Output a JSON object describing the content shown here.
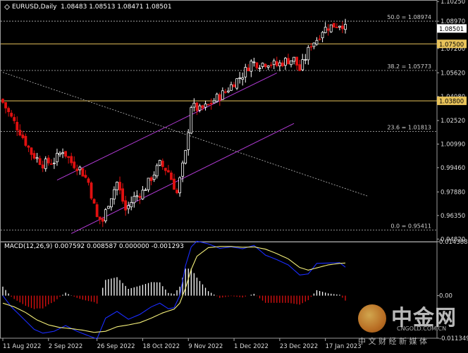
{
  "header": {
    "symbol": "EURUSD,Daily",
    "ohlc": "1.08483 1.08513 1.08471 1.08501"
  },
  "macd_header": {
    "label": "MACD(12,26,9) 0.007592 0.008587 0.000000 -0.001293"
  },
  "watermark": {
    "brand": "中金网",
    "url": "CNGOLD.COM.CN",
    "slogan": "中 文 财 经 新 媒 体"
  },
  "colors": {
    "background": "#000000",
    "bull_candle": "#ffffff",
    "bear_candle": "#e01010",
    "fib_line": "#bdbdbd",
    "horizontal_level": "#e8c35a",
    "channel": "#b23bd6",
    "macd_line": "#1a2cff",
    "signal_line": "#f5f07a",
    "hist_up": "#ffffff",
    "hist_down": "#e01010",
    "current_price_bg": "#ffffff",
    "level_label_bg": "#e8c35a"
  },
  "chart_data": [
    {
      "type": "candlestick",
      "title": "EURUSD,Daily",
      "ylim": [
        0.9465,
        1.1035
      ],
      "y_ticks": [
        "1.10250",
        "1.08970",
        "1.07200",
        "1.05620",
        "1.04080",
        "1.02520",
        "1.00990",
        "0.99460",
        "0.97880",
        "0.96350",
        "0.94820"
      ],
      "x_labels": [
        "11 Aug 2022",
        "2 Sep 2022",
        "26 Sep 2022",
        "18 Oct 2022",
        "9 Nov 2022",
        "1 Dec 2022",
        "23 Dec 2022",
        "17 Jan 2023"
      ],
      "x_label_index": [
        0,
        16,
        33,
        49,
        65,
        81,
        97,
        113
      ],
      "close_path": [
        [
          0,
          1.037
        ],
        [
          3,
          1.027
        ],
        [
          6,
          1.018
        ],
        [
          10,
          1.004
        ],
        [
          14,
          0.997
        ],
        [
          18,
          0.999
        ],
        [
          21,
          1.006
        ],
        [
          24,
          0.998
        ],
        [
          27,
          0.994
        ],
        [
          30,
          0.985
        ],
        [
          33,
          0.962
        ],
        [
          35,
          0.96
        ],
        [
          37,
          0.972
        ],
        [
          40,
          0.985
        ],
        [
          43,
          0.967
        ],
        [
          46,
          0.975
        ],
        [
          49,
          0.979
        ],
        [
          52,
          0.988
        ],
        [
          55,
          0.997
        ],
        [
          58,
          0.992
        ],
        [
          61,
          0.978
        ],
        [
          64,
          1.004
        ],
        [
          66,
          1.035
        ],
        [
          69,
          1.032
        ],
        [
          72,
          1.035
        ],
        [
          75,
          1.04
        ],
        [
          78,
          1.044
        ],
        [
          81,
          1.05
        ],
        [
          84,
          1.055
        ],
        [
          87,
          1.063
        ],
        [
          90,
          1.062
        ],
        [
          93,
          1.063
        ],
        [
          96,
          1.061
        ],
        [
          99,
          1.064
        ],
        [
          102,
          1.065
        ],
        [
          104,
          1.058
        ],
        [
          106,
          1.066
        ],
        [
          108,
          1.075
        ],
        [
          110,
          1.078
        ],
        [
          112,
          1.084
        ],
        [
          114,
          1.086
        ],
        [
          116,
          1.087
        ],
        [
          118,
          1.088
        ],
        [
          119,
          1.0876
        ],
        [
          120,
          1.085
        ]
      ],
      "fibonacci": [
        {
          "label": "50.0 = 1.08974",
          "value": 1.08974
        },
        {
          "label": "38.2 = 1.05773",
          "value": 1.05773
        },
        {
          "label": "23.6 = 1.01813",
          "value": 1.01813
        },
        {
          "label": "0.0 = 0.95411",
          "value": 0.95411
        }
      ],
      "horizontal_levels": [
        {
          "label": "1.07500",
          "value": 1.075
        },
        {
          "label": "1.03800",
          "value": 1.038
        }
      ],
      "current_price": {
        "label": "1.08501",
        "value": 1.08501
      },
      "channel_lines": [
        [
          [
            19,
            0.9865
          ],
          [
            96,
            1.0561
          ]
        ],
        [
          [
            24,
            0.9518
          ],
          [
            102,
            1.0233
          ]
        ]
      ],
      "descending_line": [
        [
          0,
          1.0565
        ],
        [
          128,
          0.976
        ]
      ]
    },
    {
      "type": "macd",
      "title": "MACD(12,26,9) 0.007592 0.008587 0.000000 -0.001293",
      "params": [
        12,
        26,
        9
      ],
      "values": [
        0.007592,
        0.008587,
        0.0,
        -0.001293
      ],
      "ylim": [
        -0.011349,
        0.014388
      ],
      "y_ticks": [
        "0.014388",
        "0.00",
        "-0.011349"
      ],
      "macd_path": [
        [
          0,
          0.0
        ],
        [
          3,
          -0.003
        ],
        [
          7,
          -0.006
        ],
        [
          11,
          -0.009
        ],
        [
          14,
          -0.01
        ],
        [
          18,
          -0.0095
        ],
        [
          22,
          -0.008
        ],
        [
          26,
          -0.0095
        ],
        [
          30,
          -0.0107
        ],
        [
          33,
          -0.0115
        ],
        [
          36,
          -0.006
        ],
        [
          40,
          -0.0042
        ],
        [
          44,
          -0.0063
        ],
        [
          48,
          -0.005
        ],
        [
          52,
          -0.003
        ],
        [
          55,
          -0.002
        ],
        [
          58,
          -0.0035
        ],
        [
          60,
          -0.0032
        ],
        [
          62,
          0.0
        ],
        [
          64,
          0.008
        ],
        [
          66,
          0.013
        ],
        [
          68,
          0.0145
        ],
        [
          72,
          0.0138
        ],
        [
          76,
          0.0126
        ],
        [
          80,
          0.013
        ],
        [
          84,
          0.0125
        ],
        [
          88,
          0.0134
        ],
        [
          92,
          0.0108
        ],
        [
          96,
          0.0096
        ],
        [
          100,
          0.0082
        ],
        [
          104,
          0.0055
        ],
        [
          107,
          0.0058
        ],
        [
          110,
          0.0086
        ],
        [
          114,
          0.0087
        ],
        [
          118,
          0.0088
        ],
        [
          120,
          0.0076
        ]
      ],
      "signal_path": [
        [
          0,
          -0.002
        ],
        [
          4,
          -0.003
        ],
        [
          8,
          -0.0045
        ],
        [
          12,
          -0.0065
        ],
        [
          16,
          -0.0078
        ],
        [
          20,
          -0.0085
        ],
        [
          24,
          -0.0088
        ],
        [
          28,
          -0.0092
        ],
        [
          32,
          -0.0098
        ],
        [
          36,
          -0.0095
        ],
        [
          40,
          -0.0083
        ],
        [
          44,
          -0.0078
        ],
        [
          48,
          -0.0072
        ],
        [
          52,
          -0.006
        ],
        [
          56,
          -0.0046
        ],
        [
          60,
          -0.0036
        ],
        [
          62,
          -0.002
        ],
        [
          64,
          0.002
        ],
        [
          66,
          0.007
        ],
        [
          68,
          0.0105
        ],
        [
          72,
          0.0128
        ],
        [
          76,
          0.0131
        ],
        [
          80,
          0.0131
        ],
        [
          84,
          0.0129
        ],
        [
          88,
          0.013
        ],
        [
          92,
          0.0124
        ],
        [
          96,
          0.0112
        ],
        [
          100,
          0.0098
        ],
        [
          104,
          0.0075
        ],
        [
          107,
          0.0068
        ],
        [
          110,
          0.0074
        ],
        [
          114,
          0.0082
        ],
        [
          118,
          0.0086
        ],
        [
          120,
          0.0087
        ]
      ]
    }
  ]
}
